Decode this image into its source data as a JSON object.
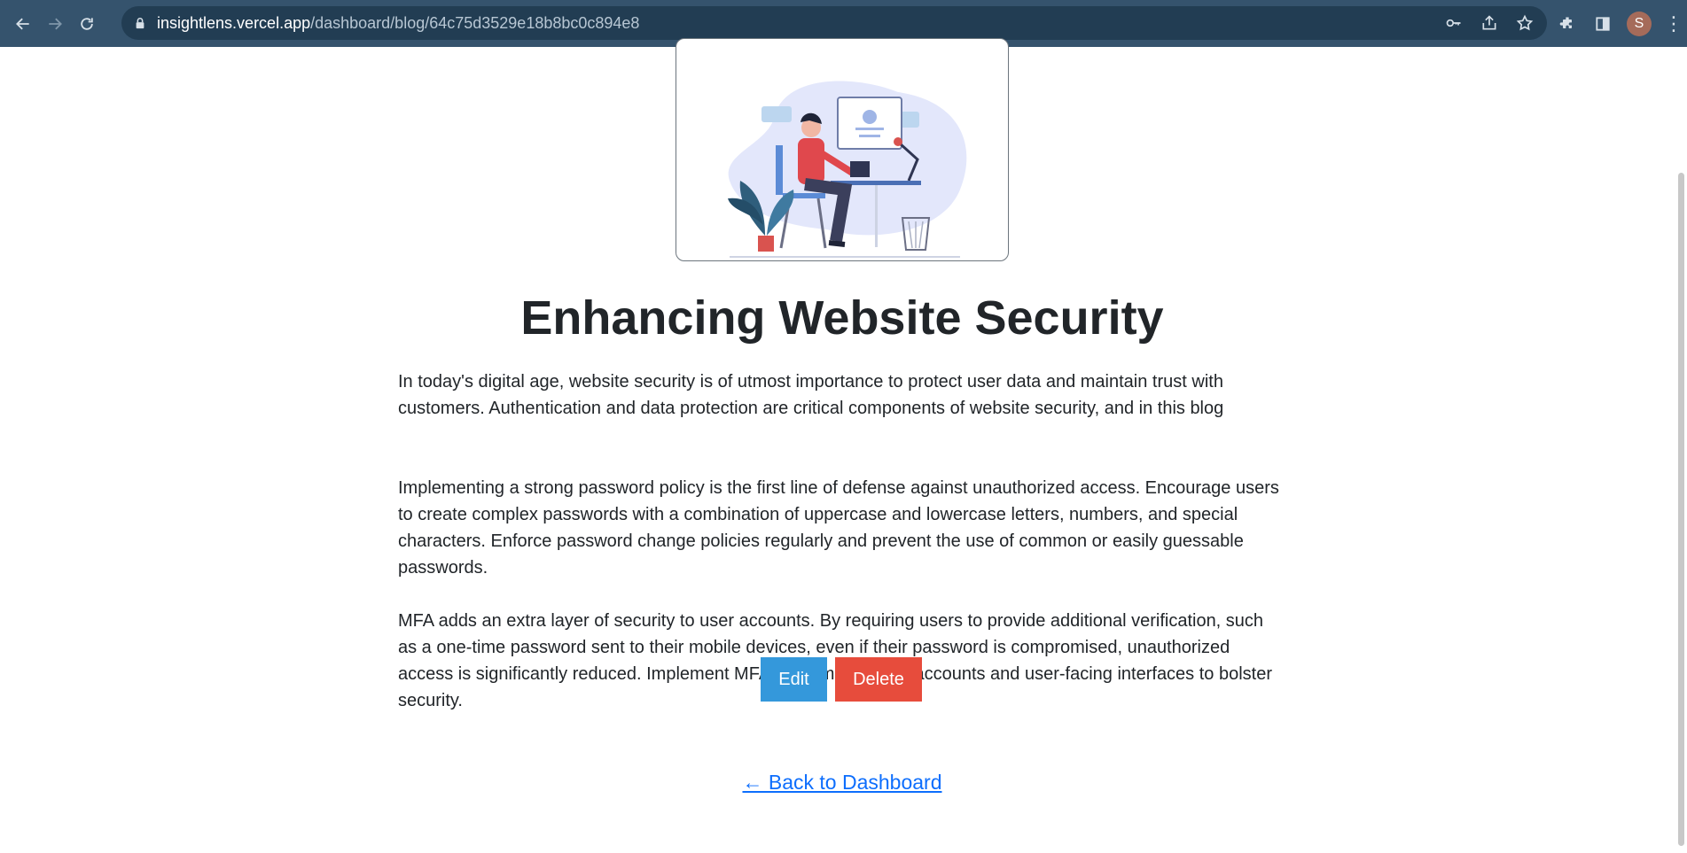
{
  "browser": {
    "url_host": "insightlens.vercel.app",
    "url_path": "/dashboard/blog/64c75d3529e18b8bc0c894e8",
    "profile_initial": "S"
  },
  "post": {
    "title": "Enhancing Website Security",
    "paragraphs": [
      "In today's digital age, website security is of utmost importance to protect user data and maintain trust with customers. Authentication and data protection are critical components of website security, and in this blog",
      "Implementing a strong password policy is the first line of defense against unauthorized access. Encourage users to create complex passwords with a combination of uppercase and lowercase letters, numbers, and special characters. Enforce password change policies regularly and prevent the use of common or easily guessable passwords.",
      "MFA adds an extra layer of security to user accounts. By requiring users to provide additional verification, such as a one-time password sent to their mobile devices, even if their password is compromised, unauthorized access is significantly reduced. Implement MFA for administrative accounts and user-facing interfaces to bolster security."
    ]
  },
  "actions": {
    "edit_label": "Edit",
    "delete_label": "Delete",
    "back_label": "← Back to Dashboard"
  },
  "colors": {
    "edit": "#3498db",
    "delete": "#e74c3c",
    "chrome": "#35536d",
    "link": "#0d6efd"
  }
}
